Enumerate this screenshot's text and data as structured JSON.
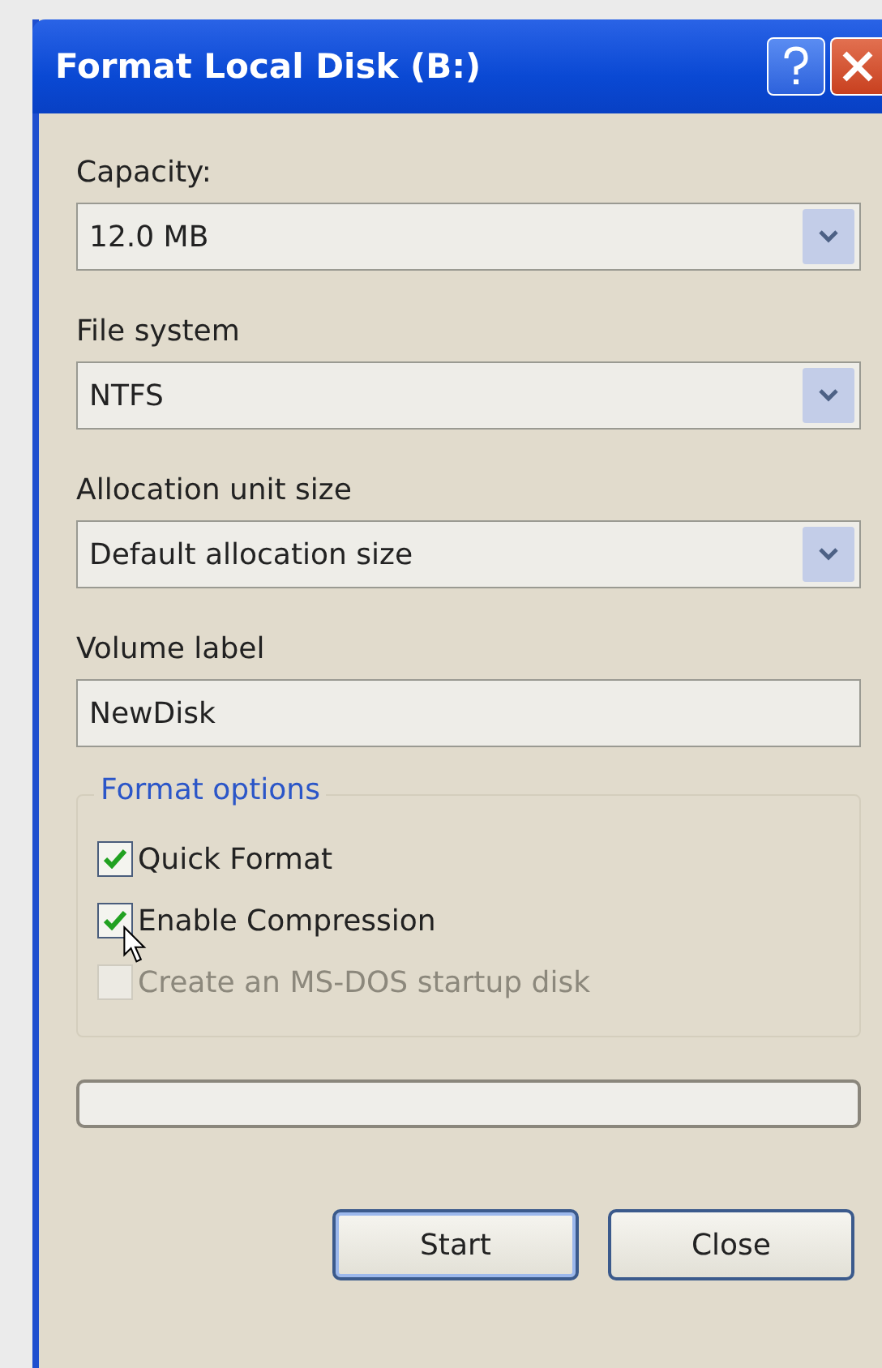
{
  "window": {
    "title": "Format Local Disk (B:)"
  },
  "fields": [
    {
      "kind": "dropdown",
      "label": "Capacity:",
      "value": "12.0 MB"
    },
    {
      "kind": "dropdown",
      "label": "File system",
      "value": "NTFS"
    },
    {
      "kind": "dropdown",
      "label": "Allocation unit size",
      "value": "Default allocation size"
    },
    {
      "kind": "text",
      "label": "Volume label",
      "value": "NewDisk"
    }
  ],
  "format_options": {
    "title": "Format options",
    "options": [
      {
        "label": "Quick Format",
        "checked": true,
        "disabled": false
      },
      {
        "label": "Enable Compression",
        "checked": true,
        "disabled": false
      },
      {
        "label": "Create an MS-DOS startup disk",
        "checked": false,
        "disabled": true
      }
    ]
  },
  "progress": {
    "level": 0
  },
  "buttons": [
    "Start",
    "Close"
  ]
}
